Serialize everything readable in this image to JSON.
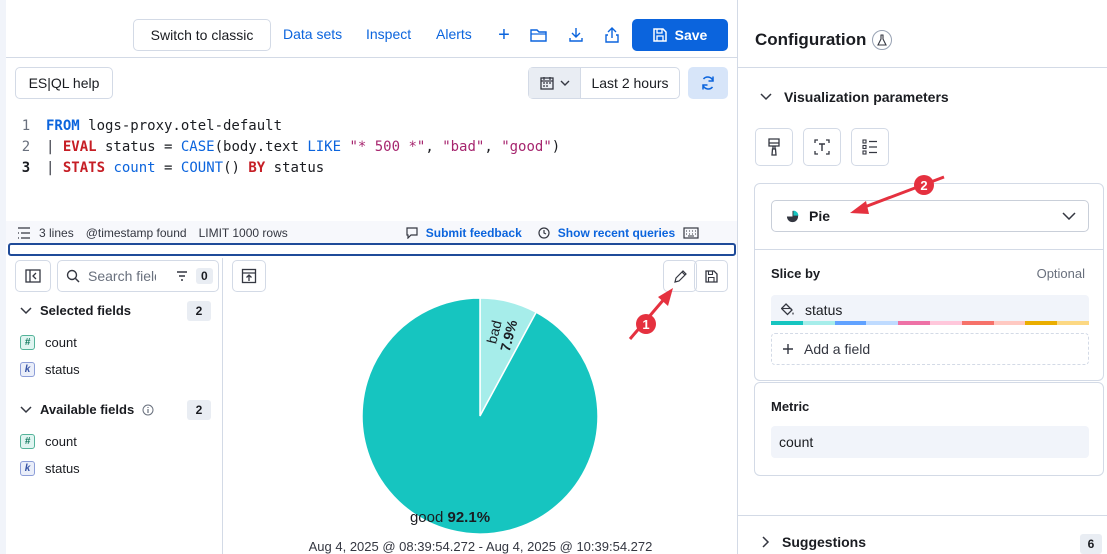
{
  "toolbar": {
    "switch_label": "Switch to classic",
    "data_sets_label": "Data sets",
    "inspect_label": "Inspect",
    "alerts_label": "Alerts",
    "add_label": "+",
    "save_label": "Save"
  },
  "editor": {
    "help_label": "ES|QL help",
    "date_range": "Last 2 hours",
    "lines": [
      {
        "num": "1",
        "active": false
      },
      {
        "num": "2",
        "active": false
      },
      {
        "num": "3",
        "active": true
      }
    ],
    "code": {
      "l1_kw": "FROM",
      "l1_rest": " logs-proxy.otel-default",
      "l2_pipe": "| ",
      "l2_kw": "EVAL",
      "l2_a": " status = ",
      "l2_fn": "CASE",
      "l2_b": "(body.text ",
      "l2_like": "LIKE",
      "l2_c": " ",
      "l2_s1": "\"* 500 *\"",
      "l2_d": ", ",
      "l2_s2": "\"bad\"",
      "l2_e": ", ",
      "l2_s3": "\"good\"",
      "l2_f": ")",
      "l3_pipe": "| ",
      "l3_kw": "STATS",
      "l3_a": " ",
      "l3_count": "count",
      "l3_b": " = ",
      "l3_fn": "COUNT",
      "l3_c": "() ",
      "l3_by": "BY",
      "l3_d": " status"
    },
    "status": {
      "lines": "3 lines",
      "timestamp": "@timestamp found",
      "limit": "LIMIT 1000 rows",
      "feedback": "Submit feedback",
      "recent": "Show recent queries"
    }
  },
  "fields": {
    "search_placeholder": "Search field names",
    "filter_count": "0",
    "selected": {
      "title": "Selected fields",
      "count": "2",
      "items": [
        "count",
        "status"
      ]
    },
    "available": {
      "title": "Available fields",
      "count": "2",
      "items": [
        "count",
        "status"
      ]
    }
  },
  "chart": {
    "time_range": "Aug 4, 2025 @ 08:39:54.272 - Aug 4, 2025 @ 10:39:54.272"
  },
  "chart_data": {
    "type": "pie",
    "categories": [
      "good",
      "bad"
    ],
    "values": [
      92.1,
      7.9
    ],
    "labels": [
      {
        "name": "good",
        "pct": "92.1%"
      },
      {
        "name": "bad",
        "pct": "7.9%"
      }
    ],
    "colors": [
      "#16c5c0",
      "#a6edea"
    ]
  },
  "config": {
    "title": "Configuration",
    "viz_params": "Visualization parameters",
    "chart_type": "Pie",
    "slice_by": "Slice by",
    "optional": "Optional",
    "dimension": "status",
    "add_field": "Add a field",
    "metric_label": "Metric",
    "metric_value": "count",
    "suggestions": "Suggestions",
    "suggestions_count": "6",
    "palette": [
      "#16c5c0",
      "#a6edea",
      "#61a2ff",
      "#bfdbff",
      "#ee72a6",
      "#ffc7db",
      "#f6726a",
      "#ffc9c2",
      "#eaae01",
      "#fcd883"
    ]
  },
  "annotations": {
    "one": "1",
    "two": "2"
  },
  "colors": {
    "accent": "#0b64dd",
    "arrow": "#e5313f"
  }
}
